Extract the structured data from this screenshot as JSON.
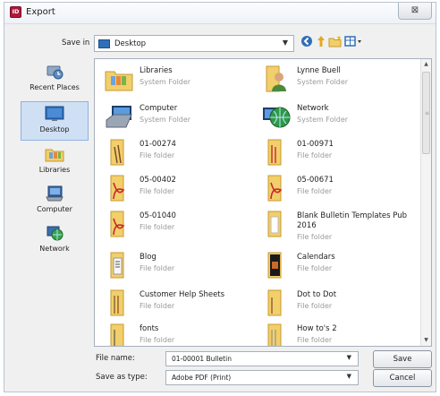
{
  "window": {
    "title": "Export",
    "close_glyph": "⊠"
  },
  "toolbar": {
    "save_in_label": "Save in",
    "save_in_value": "Desktop",
    "icons": [
      "back-icon",
      "up-folder-icon",
      "new-folder-icon",
      "view-menu-icon"
    ]
  },
  "places": [
    {
      "label": "Recent Places",
      "icon": "recent-places-icon"
    },
    {
      "label": "Desktop",
      "icon": "desktop-icon",
      "selected": true
    },
    {
      "label": "Libraries",
      "icon": "libraries-icon"
    },
    {
      "label": "Computer",
      "icon": "computer-icon"
    },
    {
      "label": "Network",
      "icon": "network-icon"
    }
  ],
  "files": [
    {
      "name": "Libraries",
      "type": "System Folder",
      "icon": "libraries-folder-icon"
    },
    {
      "name": "Lynne Buell",
      "type": "System Folder",
      "icon": "user-folder-icon"
    },
    {
      "name": "Computer",
      "type": "System Folder",
      "icon": "computer-icon"
    },
    {
      "name": "Network",
      "type": "System Folder",
      "icon": "network-icon"
    },
    {
      "name": "01-00274",
      "type": "File folder",
      "icon": "folder-icon"
    },
    {
      "name": "01-00971",
      "type": "File folder",
      "icon": "folder-icon"
    },
    {
      "name": "05-00402",
      "type": "File folder",
      "icon": "pdf-folder-icon"
    },
    {
      "name": "05-00671",
      "type": "File folder",
      "icon": "pdf-folder-icon"
    },
    {
      "name": "05-01040",
      "type": "File folder",
      "icon": "pdf-folder-icon"
    },
    {
      "name": "Blank Bulletin Templates Pub 2016",
      "type": "File folder",
      "icon": "folder-icon"
    },
    {
      "name": "Blog",
      "type": "File folder",
      "icon": "folder-icon"
    },
    {
      "name": "Calendars",
      "type": "File folder",
      "icon": "folder-icon"
    },
    {
      "name": "Customer Help Sheets",
      "type": "File folder",
      "icon": "folder-icon"
    },
    {
      "name": "Dot to Dot",
      "type": "File folder",
      "icon": "folder-icon"
    },
    {
      "name": "fonts",
      "type": "File folder",
      "icon": "folder-icon"
    },
    {
      "name": "How to's 2",
      "type": "File folder",
      "icon": "folder-icon"
    }
  ],
  "form": {
    "file_name_label": "File name:",
    "file_name_value": "01-00001 Bulletin",
    "save_as_type_label": "Save as type:",
    "save_as_type_value": "Adobe PDF (Print)"
  },
  "buttons": {
    "save": "Save",
    "cancel": "Cancel"
  },
  "colors": {
    "accent": "#2f6fb8",
    "selection": "#cfe0f4",
    "folder": "#f1cf6b",
    "pdf_red": "#c8282d"
  }
}
